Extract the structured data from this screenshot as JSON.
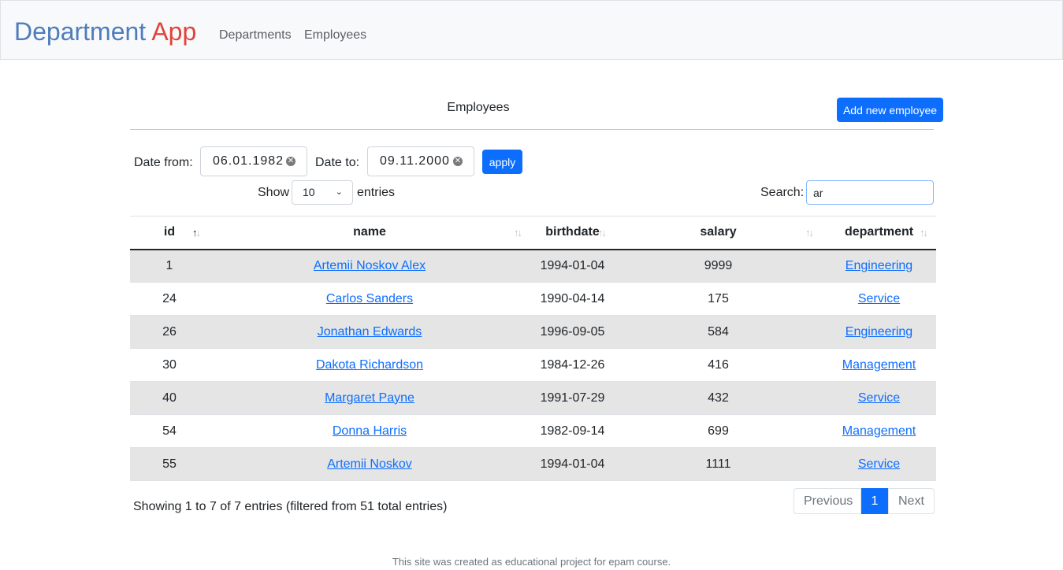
{
  "brand": {
    "part1": "Department",
    "part2": "App"
  },
  "nav": {
    "departments": "Departments",
    "employees": "Employees"
  },
  "page": {
    "heading": "Employees",
    "add_button": "Add new employee"
  },
  "filters": {
    "date_from_label": "Date from:",
    "date_from_value": "06.01.1982",
    "date_to_label": "Date to:",
    "date_to_value": "09.11.2000",
    "apply_label": "apply"
  },
  "length": {
    "show_label": "Show",
    "value": "10",
    "entries_label": "entries"
  },
  "search": {
    "label": "Search:",
    "value": "ar"
  },
  "table": {
    "columns": [
      "id",
      "name",
      "birthdate",
      "salary",
      "department"
    ],
    "sorted_column": "id",
    "rows": [
      {
        "id": "1",
        "name": "Artemii Noskov Alex",
        "birthdate": "1994-01-04",
        "salary": "9999",
        "department": "Engineering"
      },
      {
        "id": "24",
        "name": "Carlos Sanders",
        "birthdate": "1990-04-14",
        "salary": "175",
        "department": "Service"
      },
      {
        "id": "26",
        "name": "Jonathan Edwards",
        "birthdate": "1996-09-05",
        "salary": "584",
        "department": "Engineering"
      },
      {
        "id": "30",
        "name": "Dakota Richardson",
        "birthdate": "1984-12-26",
        "salary": "416",
        "department": "Management"
      },
      {
        "id": "40",
        "name": "Margaret Payne",
        "birthdate": "1991-07-29",
        "salary": "432",
        "department": "Service"
      },
      {
        "id": "54",
        "name": "Donna Harris",
        "birthdate": "1982-09-14",
        "salary": "699",
        "department": "Management"
      },
      {
        "id": "55",
        "name": "Artemii Noskov",
        "birthdate": "1994-01-04",
        "salary": "1111",
        "department": "Service"
      }
    ]
  },
  "info": "Showing 1 to 7 of 7 entries (filtered from 51 total entries)",
  "pagination": {
    "previous": "Previous",
    "current": "1",
    "next": "Next"
  },
  "footer": "This site was created as educational project for epam course.",
  "colors": {
    "primary": "#0d6efd",
    "brand_blue": "#4f7cbd",
    "brand_red": "#e0443b",
    "stripe": "#e5e5e5"
  }
}
